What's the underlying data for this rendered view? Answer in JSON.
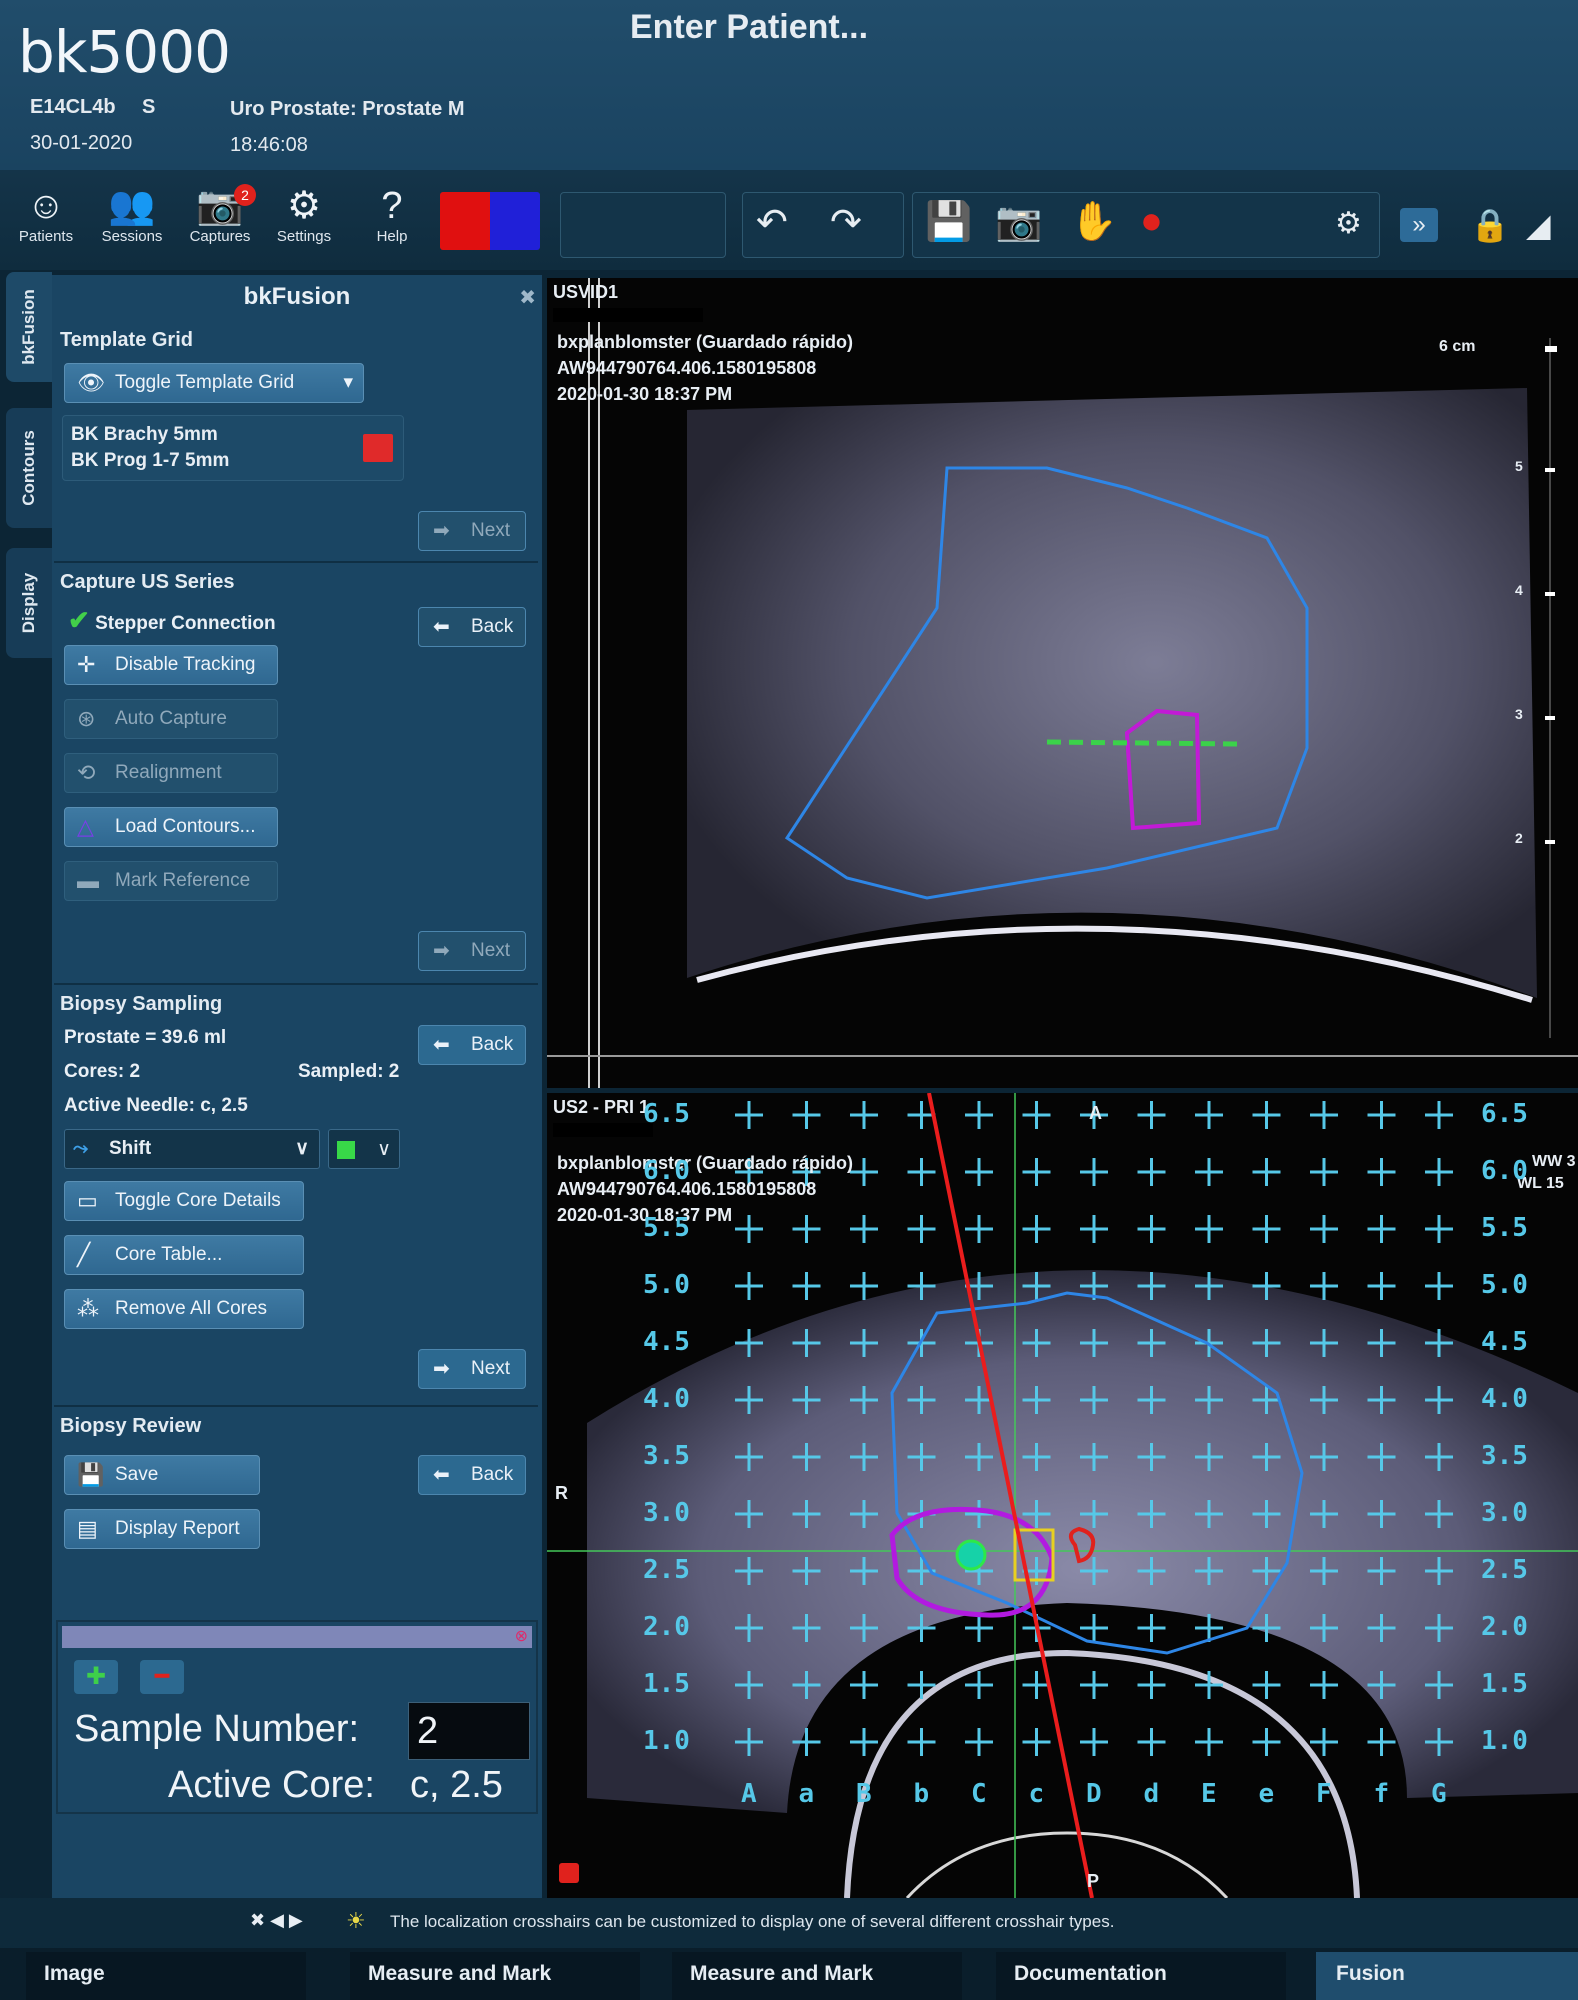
{
  "header": {
    "brand": "bk5000",
    "title": "Enter Patient...",
    "transducer": "E14CL4b",
    "mode": "S",
    "preset": "Uro Prostate: Prostate M",
    "date": "30-01-2020",
    "time": "18:46:08"
  },
  "toolbar": {
    "patients": "Patients",
    "sessions": "Sessions",
    "captures": "Captures",
    "captures_badge": "2",
    "settings": "Settings",
    "help": "Help"
  },
  "side_tabs": [
    "bkFusion",
    "Contours",
    "Display"
  ],
  "panel": {
    "title": "bkFusion",
    "template_grid": {
      "heading": "Template Grid",
      "toggle": "Toggle Template Grid",
      "template_line1": "BK Brachy 5mm",
      "template_line2": "BK Prog 1-7 5mm",
      "next": "Next"
    },
    "capture": {
      "heading": "Capture US Series",
      "stepper": "Stepper Connection",
      "back": "Back",
      "disable_tracking": "Disable Tracking",
      "auto_capture": "Auto Capture",
      "realignment": "Realignment",
      "load_contours": "Load Contours...",
      "mark_reference": "Mark Reference",
      "next": "Next"
    },
    "biopsy": {
      "heading": "Biopsy Sampling",
      "prostate": "Prostate = 39.6 ml",
      "cores": "Cores: 2",
      "sampled": "Sampled: 2",
      "active_needle": "Active Needle: c, 2.5",
      "back": "Back",
      "shift": "Shift",
      "toggle_core": "Toggle Core Details",
      "core_table": "Core Table...",
      "remove_cores": "Remove All Cores",
      "next": "Next"
    },
    "review": {
      "heading": "Biopsy Review",
      "save": "Save",
      "back": "Back",
      "report": "Display Report"
    },
    "sample": {
      "sample_label": "Sample Number:",
      "sample_value": "2",
      "core_label": "Active Core:",
      "core_value": "c, 2.5"
    }
  },
  "us1": {
    "label": "USVID1",
    "name": "bxplanblomster (Guardado rápido)",
    "id": "AW944790764.406.1580195808",
    "datetime": "2020-01-30 18:37 PM",
    "depth": "6 cm",
    "scale": [
      "5",
      "4",
      "3",
      "2"
    ]
  },
  "us2": {
    "label": "US2 - PRI 1",
    "name": "bxplanblomster (Guardado rápido)",
    "id": "AW944790764.406.1580195808",
    "datetime": "2020-01-30 18:37 PM",
    "ww": "WW 3",
    "wl": "WL 15",
    "orient_r": "R",
    "orient_a": "A",
    "orient_p": "P",
    "grid_rows": [
      "6.5",
      "6.0",
      "5.5",
      "5.0",
      "4.5",
      "4.0",
      "3.5",
      "3.0",
      "2.5",
      "2.0",
      "1.5",
      "1.0"
    ],
    "grid_cols": [
      "A",
      "a",
      "B",
      "b",
      "C",
      "c",
      "D",
      "d",
      "E",
      "e",
      "F",
      "f",
      "G"
    ]
  },
  "status": {
    "message": "The localization crosshairs can be customized to display one of several different crosshair types."
  },
  "bottom_tabs": [
    "Image",
    "Measure and Mark",
    "Measure and Mark",
    "Documentation",
    "Fusion"
  ],
  "colors": {
    "accent": "#2f6891",
    "grid": "#56c8e8",
    "contour": "#2e86e6",
    "lesion": "#c21ad6",
    "needle": "#e0221d"
  }
}
